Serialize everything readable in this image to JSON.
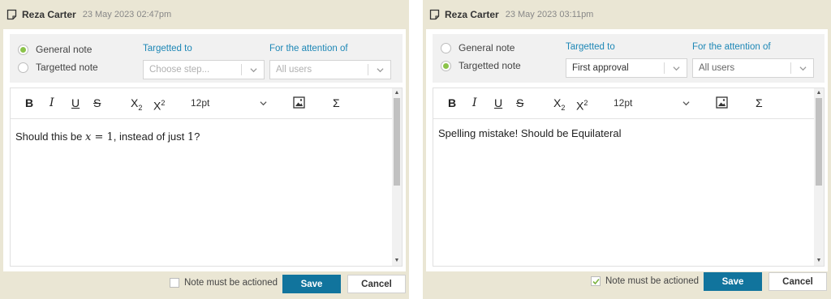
{
  "panels": [
    {
      "author": "Reza Carter",
      "timestamp": "23 May 2023 02:47pm",
      "radio_general": "General note",
      "radio_targetted": "Targetted note",
      "selected_note_type": "general",
      "targetted_to_label": "Targetted to",
      "targetted_to_value": "Choose step...",
      "attention_label": "For the attention of",
      "attention_value": "All users",
      "font_size": "12pt",
      "body_prefix": "Should this be ",
      "body_math_var": "x",
      "body_math_rest": " = 1",
      "body_mid": ", instead of just ",
      "body_math_end": "1",
      "body_suffix": "?",
      "actioned_label": "Note must be actioned",
      "actioned_checked": false,
      "save_label": "Save",
      "cancel_label": "Cancel"
    },
    {
      "author": "Reza Carter",
      "timestamp": "23 May 2023 03:11pm",
      "radio_general": "General note",
      "radio_targetted": "Targetted note",
      "selected_note_type": "targetted",
      "targetted_to_label": "Targetted to",
      "targetted_to_value": "First approval",
      "attention_label": "For the attention of",
      "attention_value": "All users",
      "font_size": "12pt",
      "body_text": "Spelling mistake! Should be Equilateral",
      "actioned_label": "Note must be actioned",
      "actioned_checked": true,
      "save_label": "Save",
      "cancel_label": "Cancel"
    }
  ],
  "toolbar": {
    "bold": "B",
    "italic": "I",
    "underline": "U",
    "strike": "S",
    "subscript": "X",
    "subscript_mark": "2",
    "superscript": "X",
    "superscript_mark": "2",
    "sigma": "Σ"
  },
  "icons": {
    "note": "note-icon",
    "image": "image-icon",
    "chevron": "chevron-down-icon",
    "check": "check-icon"
  },
  "colors": {
    "accent": "#1d87b6",
    "save_button": "#11749d",
    "radio_selected": "#8bc34a",
    "panel_background": "#eae6d4"
  }
}
